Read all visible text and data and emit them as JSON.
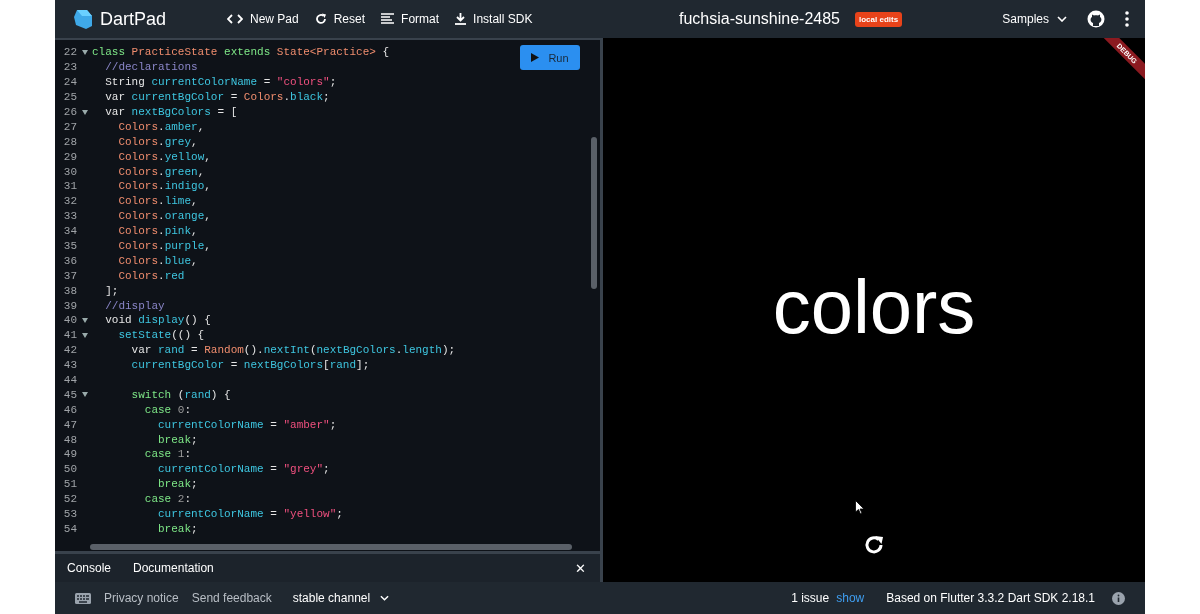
{
  "header": {
    "app_name": "DartPad",
    "actions": [
      {
        "kind": "code",
        "label": "New Pad"
      },
      {
        "kind": "reset",
        "label": "Reset"
      },
      {
        "kind": "format",
        "label": "Format"
      },
      {
        "kind": "download",
        "label": "Install SDK"
      }
    ],
    "title": "fuchsia-sunshine-2485",
    "badge": "local edits",
    "samples": "Samples"
  },
  "editor": {
    "run_button": "Run",
    "lines": [
      {
        "number": "22",
        "fold": true,
        "tokens": [
          {
            "kind": "kw",
            "text": "class "
          },
          {
            "kind": "type",
            "text": "PracticeState "
          },
          {
            "kind": "kw",
            "text": "extends "
          },
          {
            "kind": "type",
            "text": "State<Practice>"
          },
          {
            "kind": "plain",
            "text": " {"
          }
        ]
      },
      {
        "number": "23",
        "tokens": [
          {
            "kind": "comment",
            "text": "  //declarations"
          }
        ]
      },
      {
        "number": "24",
        "tokens": [
          {
            "kind": "plain",
            "text": "  String "
          },
          {
            "kind": "ident",
            "text": "currentColorName"
          },
          {
            "kind": "plain",
            "text": " = "
          },
          {
            "kind": "str",
            "text": "\"colors\""
          },
          {
            "kind": "plain",
            "text": ";"
          }
        ]
      },
      {
        "number": "25",
        "tokens": [
          {
            "kind": "plain",
            "text": "  var "
          },
          {
            "kind": "ident",
            "text": "currentBgColor"
          },
          {
            "kind": "plain",
            "text": " = "
          },
          {
            "kind": "type",
            "text": "Colors"
          },
          {
            "kind": "plain",
            "text": "."
          },
          {
            "kind": "ident",
            "text": "black"
          },
          {
            "kind": "plain",
            "text": ";"
          }
        ]
      },
      {
        "number": "26",
        "fold": true,
        "tokens": [
          {
            "kind": "plain",
            "text": "  var "
          },
          {
            "kind": "ident",
            "text": "nextBgColors"
          },
          {
            "kind": "plain",
            "text": " = ["
          }
        ]
      },
      {
        "number": "27",
        "tokens": [
          {
            "kind": "type",
            "text": "    Colors"
          },
          {
            "kind": "plain",
            "text": "."
          },
          {
            "kind": "ident",
            "text": "amber"
          },
          {
            "kind": "plain",
            "text": ","
          }
        ]
      },
      {
        "number": "28",
        "tokens": [
          {
            "kind": "type",
            "text": "    Colors"
          },
          {
            "kind": "plain",
            "text": "."
          },
          {
            "kind": "ident",
            "text": "grey"
          },
          {
            "kind": "plain",
            "text": ","
          }
        ]
      },
      {
        "number": "29",
        "tokens": [
          {
            "kind": "type",
            "text": "    Colors"
          },
          {
            "kind": "plain",
            "text": "."
          },
          {
            "kind": "ident",
            "text": "yellow"
          },
          {
            "kind": "plain",
            "text": ","
          }
        ]
      },
      {
        "number": "30",
        "tokens": [
          {
            "kind": "type",
            "text": "    Colors"
          },
          {
            "kind": "plain",
            "text": "."
          },
          {
            "kind": "ident",
            "text": "green"
          },
          {
            "kind": "plain",
            "text": ","
          }
        ]
      },
      {
        "number": "31",
        "tokens": [
          {
            "kind": "type",
            "text": "    Colors"
          },
          {
            "kind": "plain",
            "text": "."
          },
          {
            "kind": "ident",
            "text": "indigo"
          },
          {
            "kind": "plain",
            "text": ","
          }
        ]
      },
      {
        "number": "32",
        "tokens": [
          {
            "kind": "type",
            "text": "    Colors"
          },
          {
            "kind": "plain",
            "text": "."
          },
          {
            "kind": "ident",
            "text": "lime"
          },
          {
            "kind": "plain",
            "text": ","
          }
        ]
      },
      {
        "number": "33",
        "tokens": [
          {
            "kind": "type",
            "text": "    Colors"
          },
          {
            "kind": "plain",
            "text": "."
          },
          {
            "kind": "ident",
            "text": "orange"
          },
          {
            "kind": "plain",
            "text": ","
          }
        ]
      },
      {
        "number": "34",
        "tokens": [
          {
            "kind": "type",
            "text": "    Colors"
          },
          {
            "kind": "plain",
            "text": "."
          },
          {
            "kind": "ident",
            "text": "pink"
          },
          {
            "kind": "plain",
            "text": ","
          }
        ]
      },
      {
        "number": "35",
        "tokens": [
          {
            "kind": "type",
            "text": "    Colors"
          },
          {
            "kind": "plain",
            "text": "."
          },
          {
            "kind": "ident",
            "text": "purple"
          },
          {
            "kind": "plain",
            "text": ","
          }
        ]
      },
      {
        "number": "36",
        "tokens": [
          {
            "kind": "type",
            "text": "    Colors"
          },
          {
            "kind": "plain",
            "text": "."
          },
          {
            "kind": "ident",
            "text": "blue"
          },
          {
            "kind": "plain",
            "text": ","
          }
        ]
      },
      {
        "number": "37",
        "tokens": [
          {
            "kind": "type",
            "text": "    Colors"
          },
          {
            "kind": "plain",
            "text": "."
          },
          {
            "kind": "ident",
            "text": "red"
          }
        ]
      },
      {
        "number": "38",
        "tokens": [
          {
            "kind": "plain",
            "text": "  ];"
          }
        ]
      },
      {
        "number": "39",
        "tokens": [
          {
            "kind": "comment",
            "text": "  //display"
          }
        ]
      },
      {
        "number": "40",
        "fold": true,
        "tokens": [
          {
            "kind": "plain",
            "text": "  void "
          },
          {
            "kind": "ident",
            "text": "display"
          },
          {
            "kind": "plain",
            "text": "() {"
          }
        ]
      },
      {
        "number": "41",
        "fold": true,
        "tokens": [
          {
            "kind": "ident",
            "text": "    setState"
          },
          {
            "kind": "plain",
            "text": "(() {"
          }
        ]
      },
      {
        "number": "42",
        "tokens": [
          {
            "kind": "plain",
            "text": "      var "
          },
          {
            "kind": "ident",
            "text": "rand"
          },
          {
            "kind": "plain",
            "text": " = "
          },
          {
            "kind": "type",
            "text": "Random"
          },
          {
            "kind": "plain",
            "text": "()."
          },
          {
            "kind": "ident",
            "text": "nextInt"
          },
          {
            "kind": "plain",
            "text": "("
          },
          {
            "kind": "ident",
            "text": "nextBgColors"
          },
          {
            "kind": "plain",
            "text": "."
          },
          {
            "kind": "ident",
            "text": "length"
          },
          {
            "kind": "plain",
            "text": ");"
          }
        ]
      },
      {
        "number": "43",
        "tokens": [
          {
            "kind": "ident",
            "text": "      currentBgColor"
          },
          {
            "kind": "plain",
            "text": " = "
          },
          {
            "kind": "ident",
            "text": "nextBgColors"
          },
          {
            "kind": "plain",
            "text": "["
          },
          {
            "kind": "ident",
            "text": "rand"
          },
          {
            "kind": "plain",
            "text": "];"
          }
        ]
      },
      {
        "number": "44"
      },
      {
        "number": "45",
        "fold": true,
        "tokens": [
          {
            "kind": "kw",
            "text": "      switch "
          },
          {
            "kind": "plain",
            "text": "("
          },
          {
            "kind": "ident",
            "text": "rand"
          },
          {
            "kind": "plain",
            "text": ") {"
          }
        ]
      },
      {
        "number": "46",
        "tokens": [
          {
            "kind": "kw",
            "text": "        case "
          },
          {
            "kind": "num",
            "text": "0"
          },
          {
            "kind": "plain",
            "text": ":"
          }
        ]
      },
      {
        "number": "47",
        "tokens": [
          {
            "kind": "ident",
            "text": "          currentColorName"
          },
          {
            "kind": "plain",
            "text": " = "
          },
          {
            "kind": "str",
            "text": "\"amber\""
          },
          {
            "kind": "plain",
            "text": ";"
          }
        ]
      },
      {
        "number": "48",
        "tokens": [
          {
            "kind": "kw",
            "text": "          break"
          },
          {
            "kind": "plain",
            "text": ";"
          }
        ]
      },
      {
        "number": "49",
        "tokens": [
          {
            "kind": "kw",
            "text": "        case "
          },
          {
            "kind": "num",
            "text": "1"
          },
          {
            "kind": "plain",
            "text": ":"
          }
        ]
      },
      {
        "number": "50",
        "tokens": [
          {
            "kind": "ident",
            "text": "          currentColorName"
          },
          {
            "kind": "plain",
            "text": " = "
          },
          {
            "kind": "str",
            "text": "\"grey\""
          },
          {
            "kind": "plain",
            "text": ";"
          }
        ]
      },
      {
        "number": "51",
        "tokens": [
          {
            "kind": "kw",
            "text": "          break"
          },
          {
            "kind": "plain",
            "text": ";"
          }
        ]
      },
      {
        "number": "52",
        "tokens": [
          {
            "kind": "kw",
            "text": "        case "
          },
          {
            "kind": "num",
            "text": "2"
          },
          {
            "kind": "plain",
            "text": ":"
          }
        ]
      },
      {
        "number": "53",
        "tokens": [
          {
            "kind": "ident",
            "text": "          currentColorName"
          },
          {
            "kind": "plain",
            "text": " = "
          },
          {
            "kind": "str",
            "text": "\"yellow\""
          },
          {
            "kind": "plain",
            "text": ";"
          }
        ]
      },
      {
        "number": "54",
        "tokens": [
          {
            "kind": "kw",
            "text": "          break"
          },
          {
            "kind": "plain",
            "text": ";"
          }
        ]
      }
    ]
  },
  "console_tabs": [
    {
      "label": "Console"
    },
    {
      "label": "Documentation"
    }
  ],
  "console_close": "✕",
  "output": {
    "text": "colors",
    "banner": "DEBUG"
  },
  "status_bar": {
    "privacy": "Privacy notice",
    "feedback": "Send feedback",
    "channel": "stable channel",
    "issues": "1 issue",
    "show": "show",
    "version": "Based on Flutter 3.3.2 Dart SDK 2.18.1"
  }
}
